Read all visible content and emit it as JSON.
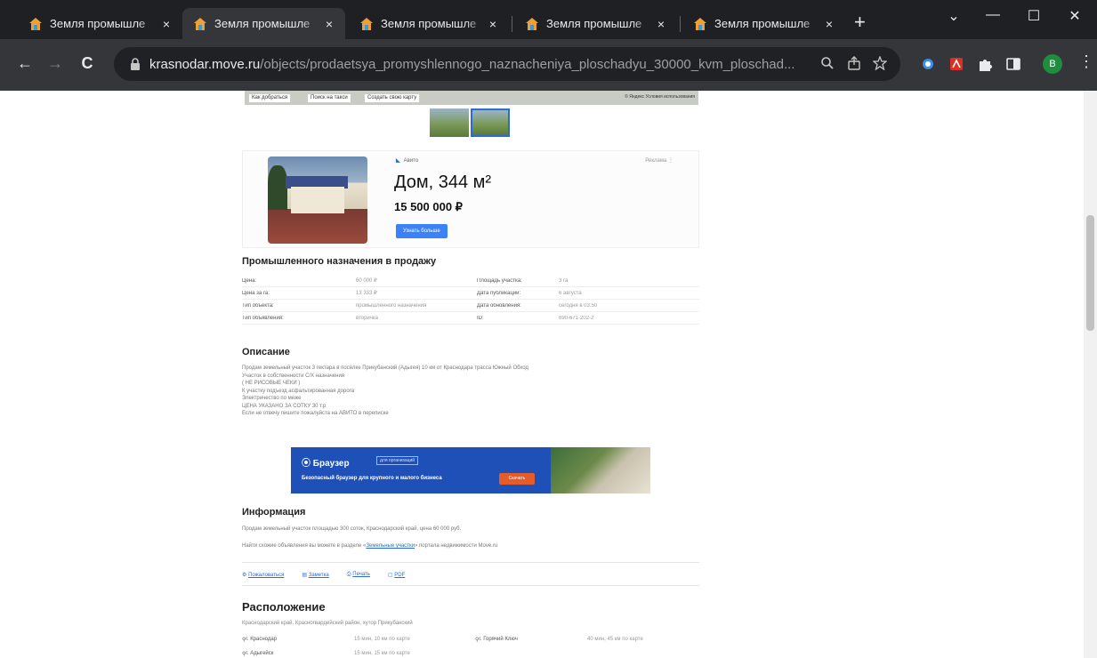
{
  "browser": {
    "tabs": [
      {
        "title": "Земля промышле",
        "close": "×"
      },
      {
        "title": "Земля промышле",
        "close": "×"
      },
      {
        "title": "Земля промышле",
        "close": "×"
      },
      {
        "title": "Земля промышле",
        "close": "×"
      },
      {
        "title": "Земля промышле",
        "close": "×"
      }
    ],
    "new_tab": "+",
    "window_controls": [
      "⌄",
      "—",
      "☐",
      "✕"
    ],
    "nav": {
      "back": "←",
      "forward": "→",
      "reload": "C"
    },
    "url_host": "krasnodar.move.ru",
    "url_path": "/objects/prodaetsya_promyshlennogo_naznacheniya_ploschadyu_30000_kvm_ploschad...",
    "profile_initial": "B",
    "menu": "⋮"
  },
  "map": {
    "buttons": [
      "Как добраться",
      "Поиск на такси",
      "Создать свою карту"
    ],
    "copyright": "© Яндекс Условия использования"
  },
  "ad": {
    "label": "Авито",
    "more": "Реклама",
    "title": "Дом, 344 м²",
    "price": "15 500 000 ₽",
    "button": "Узнать больше"
  },
  "section_title": "Промышленного назначения в продажу",
  "props": [
    {
      "k": "Цена:",
      "v": "60 000 ₽",
      "k2": "Площадь участка:",
      "v2": "3 га"
    },
    {
      "k": "Цена за га:",
      "v": "13 333 ₽",
      "k2": "Дата публикации:",
      "v2": "6 августа"
    },
    {
      "k": "Тип объекта:",
      "v": "промышленного назначения",
      "k2": "Дата обновления:",
      "v2": "сегодня в 03:50"
    },
    {
      "k": "Тип объявления:",
      "v": "вторичка",
      "k2": "ID:",
      "v2": "690-671-202-2"
    }
  ],
  "description": {
    "title": "Описание",
    "lines": [
      "Продам земельный участок 3 гектара в посёлке Прикубанский (Адыгея) 10 км от Краснодара трасса Южный Обход",
      "Участок в собственности С/Х назначения",
      "( НЕ РИСОВЫЕ ЧЕКИ )",
      "К участку подъезд асфальтированная дорога",
      "Электричество по меже",
      "ЦЕНА УКАЗАНО ЗА СОТКУ 30 т.р",
      "Если не отвечу пишите пожалуйста на АВИТО в переписке"
    ]
  },
  "banner": {
    "logo": "Браузер",
    "tag": "для организаций",
    "text": "Безопасный браузер для крупного и малого бизнеса",
    "button": "Скачать"
  },
  "info": {
    "title": "Информация",
    "line1": "Продам земельный участок площадью 300 соток, Краснодарский край, цена 60 000 руб.",
    "line2_prefix": "Найти схожие объявления вы можете в разделе «",
    "line2_link": "Земельные участки",
    "line2_suffix": "» портала недвижимости Move.ru"
  },
  "actions": [
    {
      "icon": "⚙",
      "label": "Пожаловаться"
    },
    {
      "icon": "▤",
      "label": "Заметка"
    },
    {
      "icon": "⎙",
      "label": "Печать"
    },
    {
      "icon": "▢",
      "label": "PDF"
    }
  ],
  "location": {
    "title": "Расположение",
    "address": "Краснодарский край, Красногвардейский район, хутор Прикубанский",
    "rows": [
      {
        "city": "г. Краснодар",
        "dist": "15 мин, 10 км по карте",
        "city2": "г. Горячий Ключ",
        "dist2": "40 мин, 45 км по карте"
      },
      {
        "city": "г. Адыгейск",
        "dist": "15 мин, 15 км по карте",
        "city2": "",
        "dist2": ""
      }
    ]
  }
}
